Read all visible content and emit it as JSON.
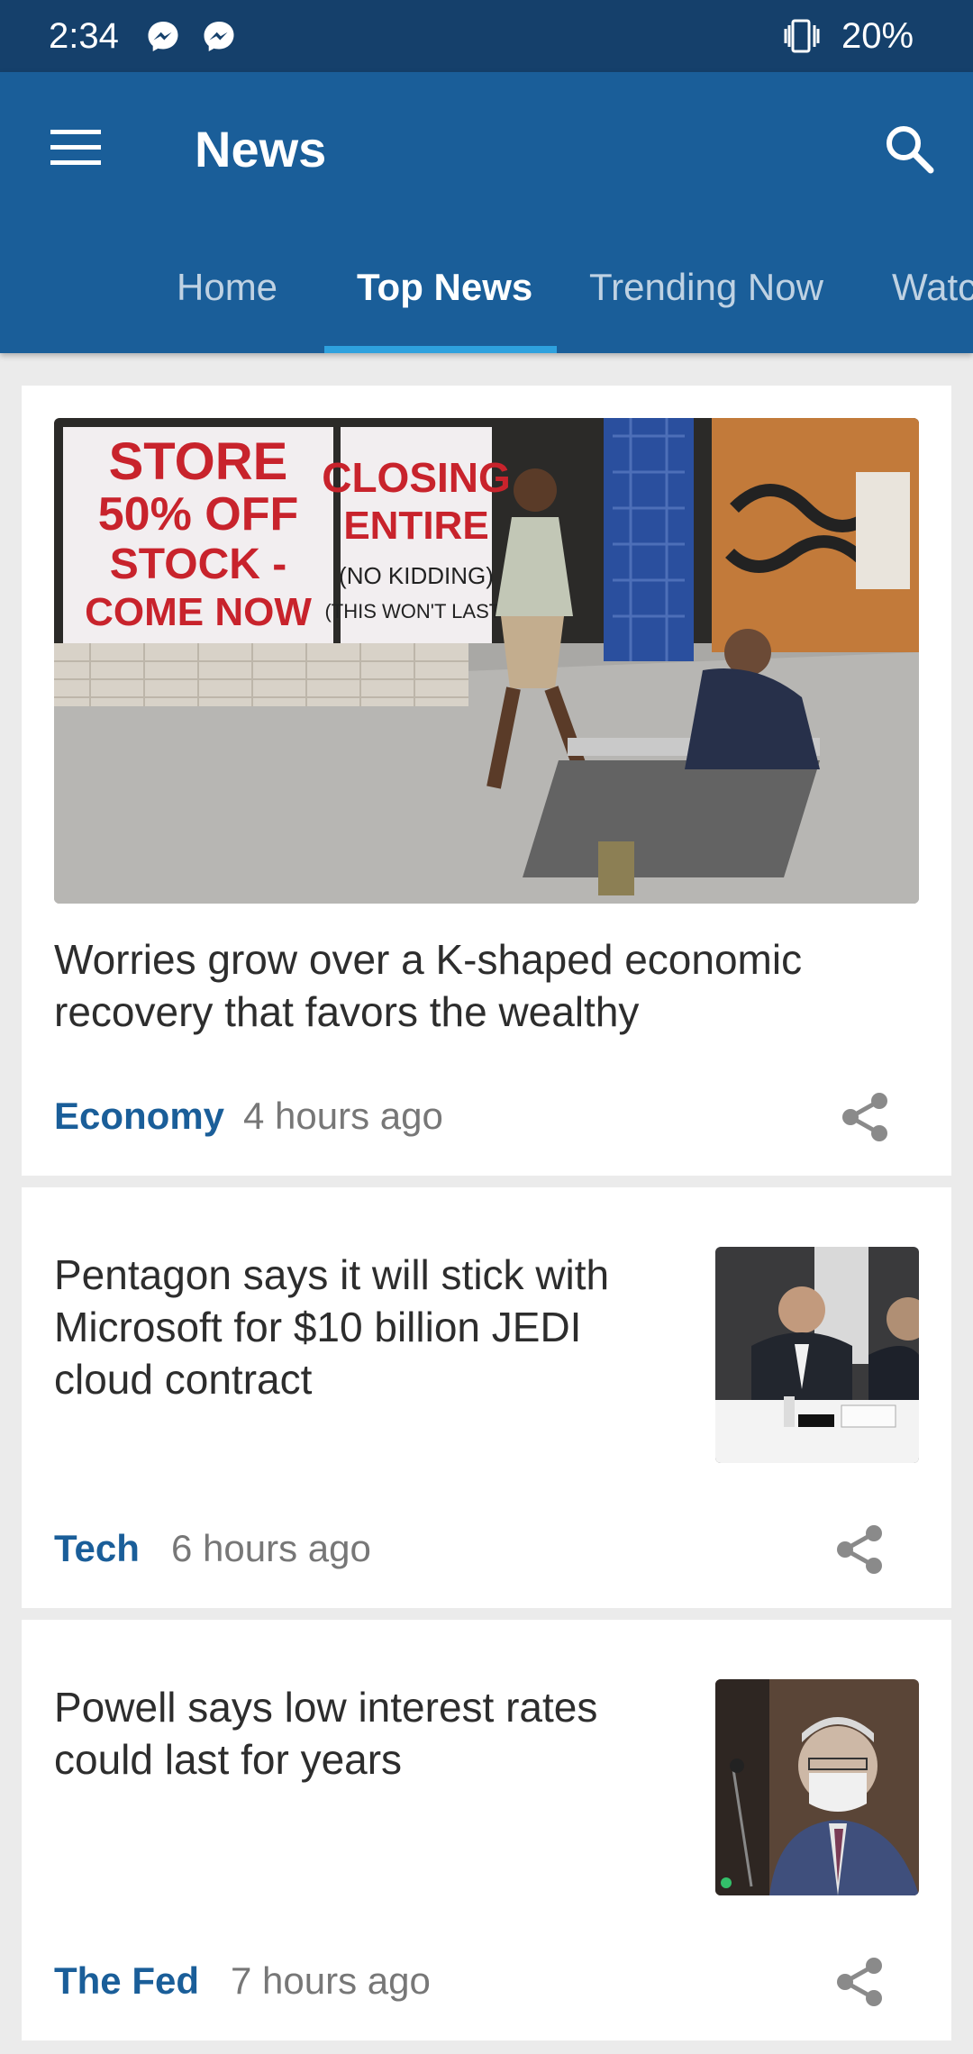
{
  "status_bar": {
    "time": "2:34",
    "battery": "20%"
  },
  "app_bar": {
    "title": "News"
  },
  "tabs": [
    {
      "label": "Home"
    },
    {
      "label": "Top News",
      "active": true
    },
    {
      "label": "Trending Now"
    },
    {
      "label": "Watc"
    }
  ],
  "articles": [
    {
      "headline": "Worries grow over a K-shaped economic recovery that favors the wealthy",
      "category": "Economy",
      "time": "4 hours ago"
    },
    {
      "headline": "Pentagon says it will stick with Microsoft for $10 billion JEDI cloud contract",
      "category": "Tech",
      "time": "6 hours ago"
    },
    {
      "headline": "Powell says low interest rates could last for years",
      "category": "The Fed",
      "time": "7 hours ago"
    }
  ],
  "hero_image": {
    "sign_left": [
      "STORE",
      "50% OFF",
      "STOCK -",
      "COME NOW"
    ],
    "sign_right": [
      "CLOSING",
      "ENTIRE",
      "(NO KIDDING)",
      "(THIS WON'T LAST)"
    ]
  },
  "colors": {
    "status_bar": "#15406b",
    "app_bar": "#1a5e99",
    "tab_indicator": "#2ea1de",
    "category": "#1a5e99"
  }
}
